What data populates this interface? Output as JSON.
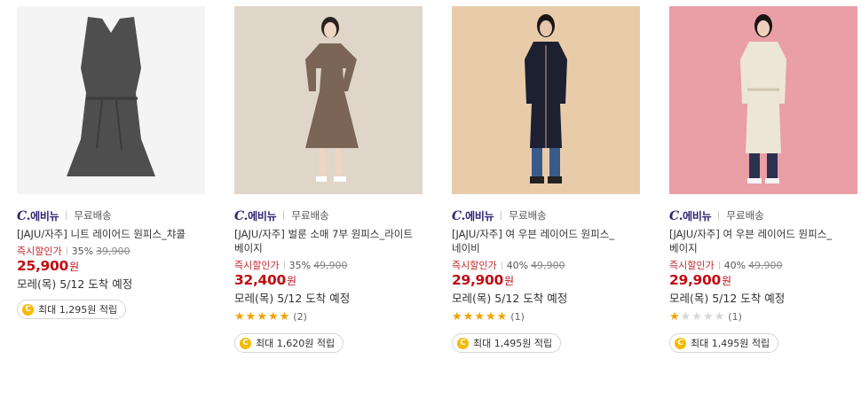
{
  "products": [
    {
      "brand_c": "C.",
      "brand_name": "에비뉴",
      "shipping": "무료배송",
      "title": "[JAJU/자주] 니트 레이어드 원피스_챠콜",
      "discount_label": "즉시할인가",
      "discount_rate": "35%",
      "original_price": "39,900",
      "price": "25,900",
      "currency": "원",
      "delivery": "모레(목) 5/12 도착 예정",
      "stars_filled": 0,
      "review_count": "",
      "point_text": "최대 1,295원 적립",
      "bg_color": "#f4f4f4",
      "dress_color": "#4e4e4e"
    },
    {
      "brand_c": "C.",
      "brand_name": "에비뉴",
      "shipping": "무료배송",
      "title": "[JAJU/자주] 벌룬 소매 7부 원피스_라이트 베이지",
      "discount_label": "즉시할인가",
      "discount_rate": "35%",
      "original_price": "49,900",
      "price": "32,400",
      "currency": "원",
      "delivery": "모레(목) 5/12 도착 예정",
      "stars_filled": 5,
      "review_count": "(2)",
      "point_text": "최대 1,620원 적립",
      "bg_color": "#dfd6c9",
      "dress_color": "#7a6556"
    },
    {
      "brand_c": "C.",
      "brand_name": "에비뉴",
      "shipping": "무료배송",
      "title": "[JAJU/자주] 여 우븐 레이어드 원피스_네이비",
      "discount_label": "즉시할인가",
      "discount_rate": "40%",
      "original_price": "49,900",
      "price": "29,900",
      "currency": "원",
      "delivery": "모레(목) 5/12 도착 예정",
      "stars_filled": 5,
      "review_count": "(1)",
      "point_text": "최대 1,495원 적립",
      "bg_color": "#e8ccaa",
      "dress_color": "#1d2030"
    },
    {
      "brand_c": "C.",
      "brand_name": "에비뉴",
      "shipping": "무료배송",
      "title": "[JAJU/자주] 여 우븐 레이어드 원피스_베이지",
      "discount_label": "즉시할인가",
      "discount_rate": "40%",
      "original_price": "49,900",
      "price": "29,900",
      "currency": "원",
      "delivery": "모레(목) 5/12 도착 예정",
      "stars_filled": 1,
      "review_count": "(1)",
      "point_text": "최대 1,495원 적립",
      "bg_color": "#ea9ea6",
      "dress_color": "#ece6d6"
    }
  ],
  "icons": {
    "star": "star-icon",
    "coin": "point-coin-icon",
    "coin_glyph": "C"
  },
  "colors": {
    "brand": "#2f2474",
    "sale_red": "#c00d14",
    "star_on": "#f2a100",
    "star_off": "#d6d6d6",
    "coin": "#f6b900"
  }
}
